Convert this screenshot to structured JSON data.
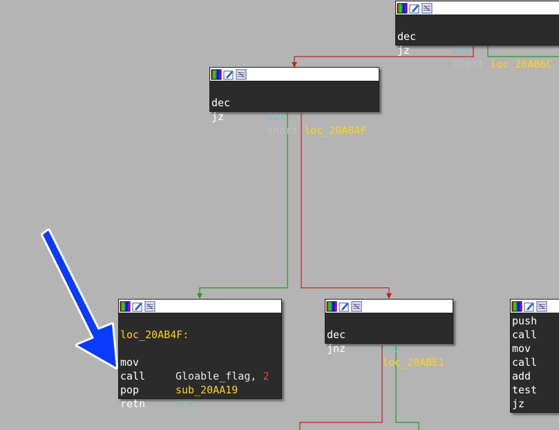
{
  "nodes": {
    "top_right": {
      "rows": [
        {
          "mn": "dec",
          "op": "eax"
        },
        {
          "mn": "jz",
          "op_pre": "short",
          "op_lbl": "loc_20AB6C"
        }
      ]
    },
    "upper": {
      "rows": [
        {
          "mn": "dec",
          "op": "eax"
        },
        {
          "mn": "jz",
          "op_pre": "short",
          "op_lbl": "loc_20AB4F"
        }
      ]
    },
    "target": {
      "label": "loc_20AB4F:",
      "rows": [
        {
          "mn": "mov",
          "op_sym": "Gloable_flag",
          "op_sep": ", ",
          "op_num": "2"
        },
        {
          "mn": "call",
          "op_lbl": "sub_20AA19"
        },
        {
          "mn": "pop",
          "op": "ecx"
        },
        {
          "mn": "retn"
        }
      ]
    },
    "middle": {
      "rows": [
        {
          "mn": "dec",
          "op": "eax"
        },
        {
          "mn": "jnz",
          "op_lbl": "loc_20ABE1"
        }
      ]
    },
    "right": {
      "rows": [
        {
          "mn": "push"
        },
        {
          "mn": "call"
        },
        {
          "mn": "mov"
        },
        {
          "mn": "call"
        },
        {
          "mn": "add"
        },
        {
          "mn": "test"
        },
        {
          "mn": "jz"
        }
      ]
    }
  },
  "colors": {
    "background": "#b4b4b4",
    "node_bg": "#2b2b2b",
    "edge_true": "#1e9b1e",
    "edge_false": "#c02020",
    "arrow": "#0a3cff",
    "label": "#ffd21a",
    "register": "#7fbfbf",
    "immediate": "#e04848"
  },
  "icons": [
    "palette-icon",
    "edit-icon",
    "graph-icon"
  ]
}
